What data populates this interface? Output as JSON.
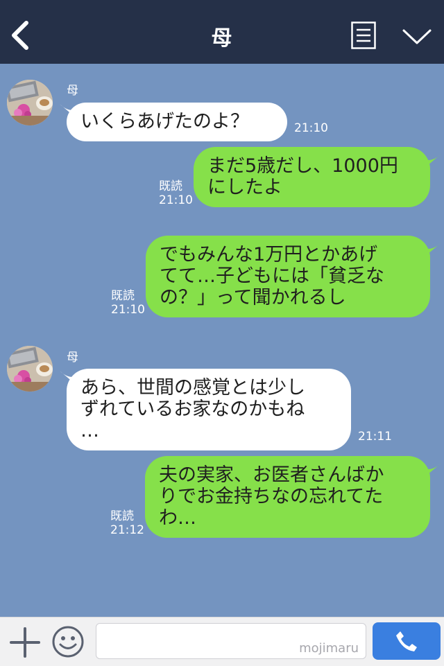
{
  "header": {
    "title": "母",
    "back_icon": "chevron-left-icon",
    "menu_icon": "notes-icon",
    "dropdown_icon": "chevron-down-icon"
  },
  "messages": [
    {
      "side": "in",
      "sender": "母",
      "text": "いくらあげたのよ？",
      "time": "21:10"
    },
    {
      "side": "out",
      "read": "既読",
      "text": "まだ5歳だし、1000円\nにしたよ",
      "time": "21:10"
    },
    {
      "side": "out",
      "read": "既読",
      "text": "でもみんな1万円とかあげ\nてて…子どもには「貧乏な\nの？」って聞かれるし",
      "time": "21:10"
    },
    {
      "side": "in",
      "sender": "母",
      "text": "あら、世間の感覚とは少し\nずれているお家なのかもね\n…",
      "time": "21:11"
    },
    {
      "side": "out",
      "read": "既読",
      "text": "夫の実家、お医者さんばか\nりでお金持ちなの忘れてた\nわ…",
      "time": "21:12"
    }
  ],
  "footer": {
    "watermark": "mojimaru",
    "plus_icon": "plus-icon",
    "emoji_icon": "smile-icon",
    "send_icon": "phone-icon"
  },
  "colors": {
    "header_bg": "#253048",
    "chat_bg": "#7494c0",
    "incoming_bubble": "#ffffff",
    "outgoing_bubble": "#86e04a",
    "send_button": "#3a7fe0"
  }
}
